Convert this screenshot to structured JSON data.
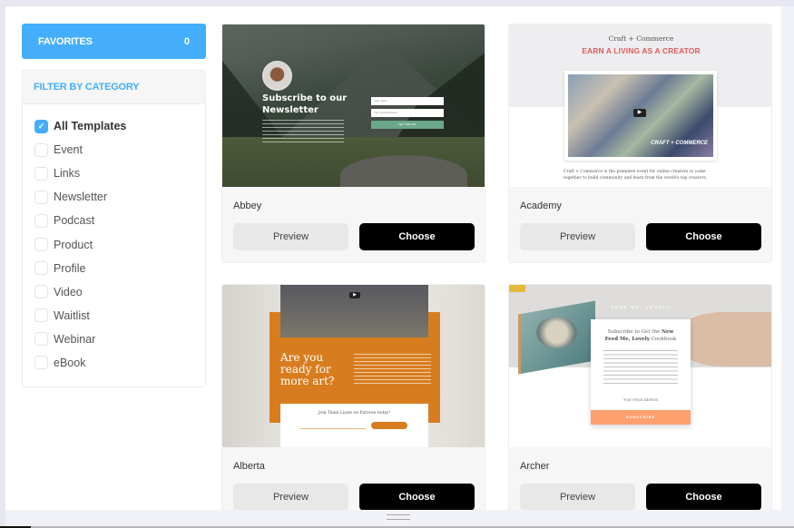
{
  "sidebar": {
    "favorites": {
      "label": "FAVORITES",
      "count": "0",
      "color": "#45aefc"
    },
    "filter": {
      "title": "FILTER BY CATEGORY",
      "items": [
        {
          "label": "All Templates",
          "checked": true
        },
        {
          "label": "Event",
          "checked": false
        },
        {
          "label": "Links",
          "checked": false
        },
        {
          "label": "Newsletter",
          "checked": false
        },
        {
          "label": "Podcast",
          "checked": false
        },
        {
          "label": "Product",
          "checked": false
        },
        {
          "label": "Profile",
          "checked": false
        },
        {
          "label": "Video",
          "checked": false
        },
        {
          "label": "Waitlist",
          "checked": false
        },
        {
          "label": "Webinar",
          "checked": false
        },
        {
          "label": "eBook",
          "checked": false
        }
      ]
    }
  },
  "templates": [
    {
      "name": "Abbey",
      "preview_label": "Preview",
      "choose_label": "Choose",
      "thumb": {
        "heading": "Subscribe to our Newsletter",
        "name_placeholder": "Your name",
        "email_placeholder": "Your email address",
        "button": "GET THE APP"
      }
    },
    {
      "name": "Academy",
      "preview_label": "Preview",
      "choose_label": "Choose",
      "thumb": {
        "subtitle": "Craft + Commerce",
        "heading": "EARN A LIVING AS A CREATOR",
        "logo": "CRAFT + COMMERCE",
        "description": "Craft + Commerce is the premiere event for online creators to come together to build community and learn from the world's top creators."
      }
    },
    {
      "name": "Alberta",
      "preview_label": "Preview",
      "choose_label": "Choose",
      "thumb": {
        "heading": "Are you ready for more art?",
        "cta": "Join Team Lizzie on Patreon today!"
      }
    },
    {
      "name": "Archer",
      "preview_label": "Preview",
      "choose_label": "Choose",
      "thumb": {
        "brand": "FEED ME, LOVELY",
        "heading_pre": "Subscribe to Get the ",
        "heading_bold1": "New",
        "heading_bold2": "Feed Me, Lovely",
        "heading_post": " Cookbook",
        "email_placeholder": "Your email address",
        "button": "SUBSCRIBE"
      }
    }
  ]
}
